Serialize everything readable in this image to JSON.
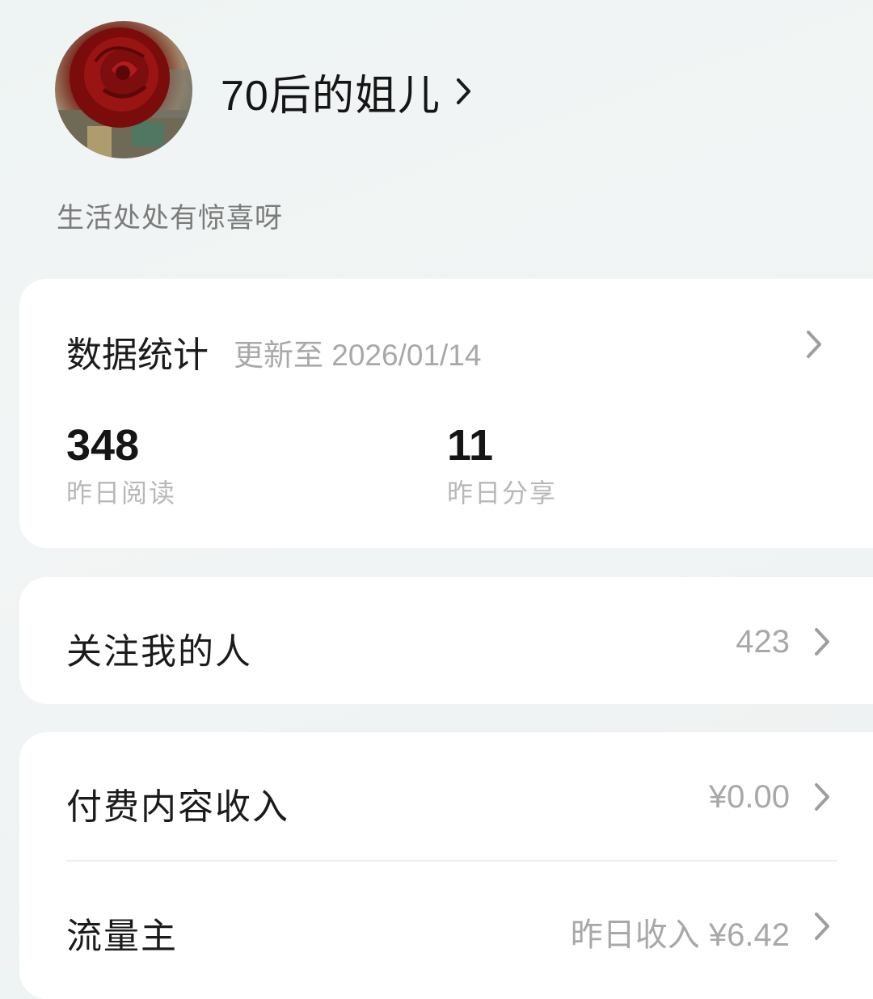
{
  "profile": {
    "name": "70后的姐儿",
    "bio": "生活处处有惊喜呀"
  },
  "stats": {
    "title": "数据统计",
    "updated": "更新至 2026/01/14",
    "items": [
      {
        "value": "348",
        "label": "昨日阅读"
      },
      {
        "value": "11",
        "label": "昨日分享"
      }
    ]
  },
  "followers": {
    "label": "关注我的人",
    "value": "423"
  },
  "income": {
    "paid_label": "付费内容收入",
    "paid_value": "¥0.00",
    "traffic_label": "流量主",
    "traffic_value": "昨日收入 ¥6.42"
  },
  "colors": {
    "background": "#eef3f2",
    "card": "#ffffff",
    "secondary_text": "#a8a8a8",
    "rose": "#8a1010"
  },
  "icons": [
    "avatar-rose-photo",
    "chevron-right-icon"
  ]
}
